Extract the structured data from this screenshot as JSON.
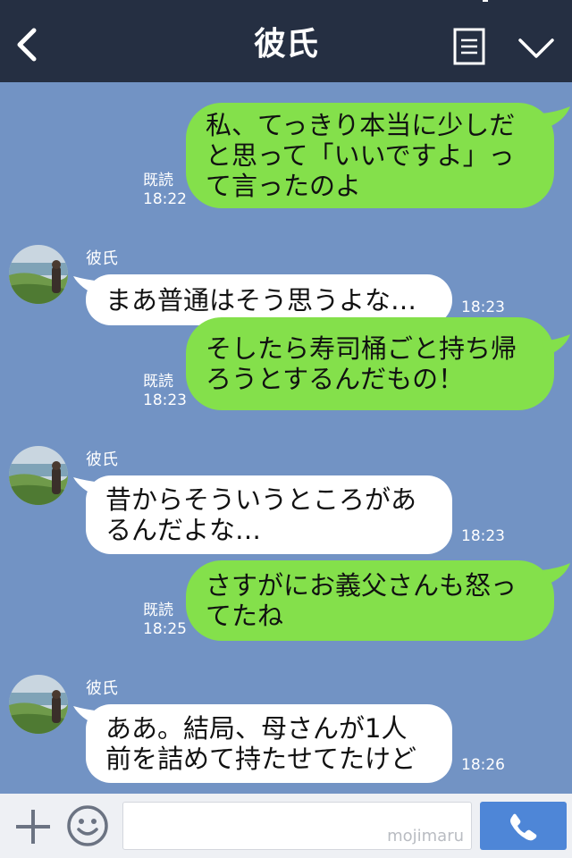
{
  "header": {
    "title": "彼氏",
    "back_icon": "chevron-left-icon",
    "menu_icon": "notes-icon",
    "collapse_icon": "chevron-down-icon"
  },
  "messages": [
    {
      "side": "me",
      "lines": [
        "私、てっきり本当に少しだ",
        "と思って「いいですよ」っ",
        "て言ったのよ"
      ],
      "read": "既読",
      "time": "18:22"
    },
    {
      "side": "them",
      "sender": "彼氏",
      "lines": [
        "まあ普通はそう思うよな…"
      ],
      "time": "18:23"
    },
    {
      "side": "me",
      "lines": [
        "そしたら寿司桶ごと持ち帰",
        "ろうとするんだもの！"
      ],
      "read": "既読",
      "time": "18:23"
    },
    {
      "side": "them",
      "sender": "彼氏",
      "lines": [
        "昔からそういうところがあ",
        "るんだよな…"
      ],
      "time": "18:23"
    },
    {
      "side": "me",
      "lines": [
        "さすがにお義父さんも怒っ",
        "てたね"
      ],
      "read": "既読",
      "time": "18:25"
    },
    {
      "side": "them",
      "sender": "彼氏",
      "lines": [
        "ああ。結局、母さんが1人",
        "前を詰めて持たせてたけど"
      ],
      "time": "18:26"
    }
  ],
  "input": {
    "watermark": "mojimaru",
    "plus_icon": "plus-icon",
    "emoji_icon": "smiley-icon",
    "send_icon": "phone-icon"
  },
  "colors": {
    "header_bg": "#252f42",
    "chat_bg": "#7293c4",
    "my_bubble": "#84e04b",
    "their_bubble": "#ffffff",
    "send_button": "#4e86d7"
  }
}
